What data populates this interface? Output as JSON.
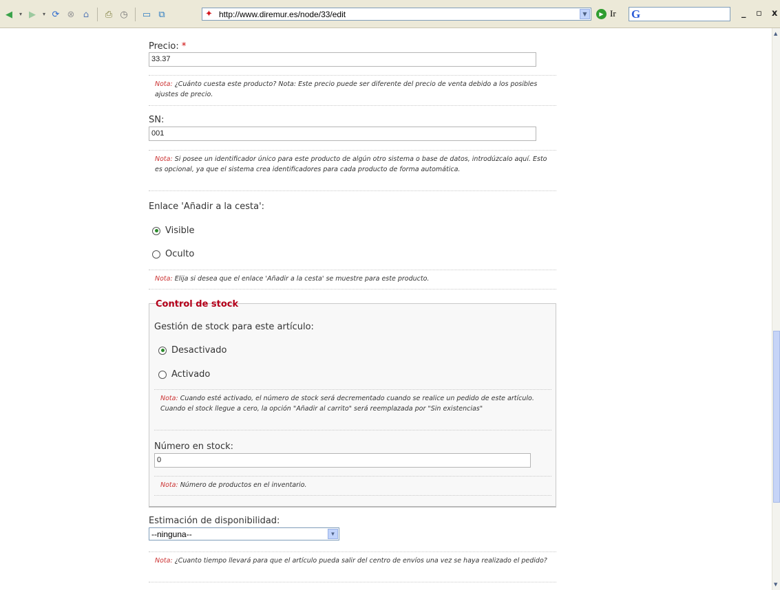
{
  "browser": {
    "url": "http://www.diremur.es/node/33/edit",
    "go_label": "Ir",
    "google_logo": "G",
    "icons": [
      "back-icon",
      "back-dropdown-icon",
      "forward-icon",
      "forward-dropdown-icon",
      "refresh-icon",
      "stop-icon",
      "home-icon",
      "print-icon",
      "history-icon",
      "mail-icon",
      "news-icon"
    ]
  },
  "form": {
    "price": {
      "label": "Precio:",
      "required_mark": "*",
      "value": "33.37",
      "note_prefix": "Nota:",
      "note_text": " ¿Cuánto cuesta este producto? Nota: Este precio puede ser diferente del precio de venta debido a los posibles ajustes de precio."
    },
    "sn": {
      "label": "SN:",
      "value": "001",
      "note_prefix": "Nota:",
      "note_text": " Si posee un identificador único para este producto de algún otro sistema o base de datos, introdúzcalo aquí. Esto es opcional, ya que el sistema crea identificadores para cada producto de forma automática."
    },
    "cart_link": {
      "label": "Enlace 'Añadir a la cesta':",
      "options": [
        "Visible",
        "Oculto"
      ],
      "selected": "Visible",
      "note_prefix": "Nota:",
      "note_text": " Elija si desea que el enlace 'Añadir a la cesta' se muestre para este producto."
    },
    "stock": {
      "legend": "Control de stock",
      "management_label": "Gestión de stock para este artículo:",
      "options": [
        "Desactivado",
        "Activado"
      ],
      "selected": "Desactivado",
      "note_prefix": "Nota:",
      "note_text": " Cuando esté activado, el número de stock será decrementado cuando se realice un pedido de este artículo. Cuando el stock llegue a cero, la opción \"Añadir al carrito\" será reemplazada por \"Sin existencias\"",
      "count_label": "Número en stock:",
      "count_value": "0",
      "count_note_prefix": "Nota:",
      "count_note_text": " Número de productos en el inventario."
    },
    "availability": {
      "label": "Estimación de disponibilidad:",
      "selected": "--ninguna--",
      "note_prefix": "Nota:",
      "note_text": " ¿Cuanto tiempo llevará para que el artículo pueda salir del centro de envíos una vez se haya realizado el pedido?"
    }
  }
}
